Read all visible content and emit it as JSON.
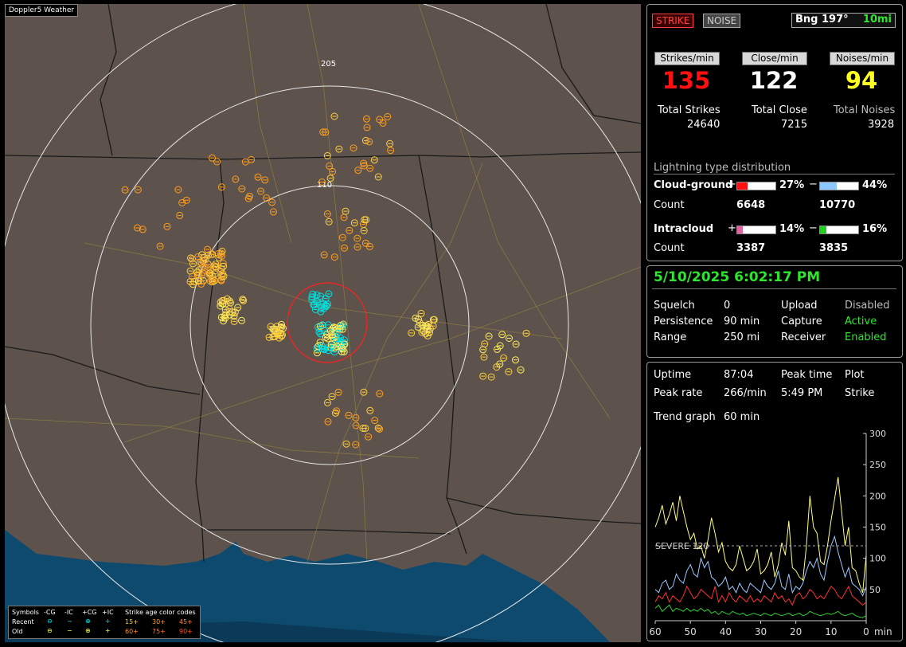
{
  "map": {
    "title": "Doppler5 Weather",
    "ring_labels": [
      "205",
      "110"
    ],
    "legend": {
      "symbols_label": "Symbols",
      "col_neg_cg": "-CG",
      "col_neg_ic": "-IC",
      "col_pos_cg": "+CG",
      "col_pos_ic": "+IC",
      "age_title": "Strike age color codes",
      "recent_label": "Recent",
      "old_label": "Old",
      "recent_ages": [
        "15+",
        "30+",
        "45+"
      ],
      "old_ages": [
        "60+",
        "75+",
        "90+"
      ],
      "colors": {
        "recent": "#00e0e0",
        "old": "#ffff40",
        "age15": "#ffd040",
        "age30": "#ffa020",
        "age45": "#ff8020",
        "age60": "#ff9020",
        "age75": "#ff7020",
        "age90": "#ff5020"
      }
    }
  },
  "status": {
    "strike_label": "STRIKE",
    "noise_label": "NOISE",
    "bearing": "Bng 197°",
    "distance": "10mi",
    "strikes_min_label": "Strikes/min",
    "close_min_label": "Close/min",
    "noises_min_label": "Noises/min",
    "strikes_min": "135",
    "close_min": "122",
    "noises_min": "94",
    "total_strikes_label": "Total Strikes",
    "total_close_label": "Total Close",
    "total_noises_label": "Total Noises",
    "total_strikes": "24640",
    "total_close": "7215",
    "total_noises": "3928",
    "dist_title": "Lightning type distribution",
    "cg_label": "Cloud-ground",
    "ic_label": "Intracloud",
    "plus": "+",
    "minus": "−",
    "cg_pos_pct": "27%",
    "cg_neg_pct": "44%",
    "ic_pos_pct": "14%",
    "ic_neg_pct": "16%",
    "cg_pos_frac": 0.27,
    "cg_neg_frac": 0.44,
    "ic_pos_frac": 0.14,
    "ic_neg_frac": 0.16,
    "count_label": "Count",
    "cg_pos_count": "6648",
    "cg_neg_count": "10770",
    "ic_pos_count": "3387",
    "ic_neg_count": "3835"
  },
  "settings": {
    "datetime": "5/10/2025 6:02:17 PM",
    "squelch_label": "Squelch",
    "squelch": "0",
    "persistence_label": "Persistence",
    "persistence": "90 min",
    "range_label": "Range",
    "range": "250 mi",
    "upload_label": "Upload",
    "upload": "Disabled",
    "capture_label": "Capture",
    "capture": "Active",
    "receiver_label": "Receiver",
    "receiver": "Enabled"
  },
  "stats": {
    "uptime_label": "Uptime",
    "uptime": "87:04",
    "peak_time_label": "Peak time",
    "peak_time": "5:49 PM",
    "plot_label": "Plot",
    "plot": "Strike",
    "peak_rate_label": "Peak rate",
    "peak_rate": "266/min",
    "trend_label": "Trend graph",
    "trend": "60 min"
  },
  "chart_data": {
    "type": "line",
    "title": "",
    "xlabel": "min",
    "ylabel": "",
    "x_ticks": [
      "60",
      "50",
      "40",
      "30",
      "20",
      "10",
      "0"
    ],
    "xlim": [
      60,
      0
    ],
    "y_ticks": [
      "300",
      "250",
      "200",
      "150",
      "100",
      "50"
    ],
    "ylim": [
      0,
      300
    ],
    "severe_label": "SEVERE 120",
    "severe_value": 120,
    "series": [
      {
        "color": "#ffff80",
        "values": [
          150,
          165,
          185,
          155,
          170,
          190,
          160,
          200,
          175,
          150,
          130,
          140,
          115,
          120,
          100,
          130,
          165,
          140,
          110,
          125,
          95,
          85,
          80,
          90,
          120,
          100,
          80,
          85,
          95,
          115,
          75,
          80,
          90,
          110,
          70,
          90,
          125,
          105,
          160,
          85,
          80,
          70,
          65,
          120,
          200,
          150,
          140,
          95,
          90,
          120,
          160,
          195,
          230,
          175,
          120,
          150,
          85,
          80,
          60,
          45,
          105
        ]
      },
      {
        "color": "#9ec8ff",
        "values": [
          50,
          45,
          60,
          65,
          50,
          55,
          75,
          65,
          60,
          80,
          90,
          75,
          70,
          100,
          85,
          95,
          70,
          65,
          55,
          60,
          70,
          50,
          55,
          45,
          60,
          50,
          45,
          60,
          55,
          50,
          45,
          65,
          55,
          50,
          60,
          80,
          55,
          50,
          75,
          45,
          55,
          50,
          60,
          80,
          95,
          85,
          100,
          75,
          65,
          95,
          120,
          135,
          110,
          90,
          70,
          85,
          60,
          55,
          50,
          40,
          55
        ]
      },
      {
        "color": "#ff3030",
        "values": [
          30,
          40,
          35,
          45,
          30,
          40,
          35,
          30,
          40,
          55,
          45,
          35,
          40,
          50,
          45,
          40,
          35,
          55,
          30,
          40,
          30,
          45,
          35,
          30,
          40,
          35,
          30,
          40,
          30,
          35,
          30,
          40,
          35,
          30,
          45,
          35,
          40,
          30,
          35,
          25,
          40,
          45,
          35,
          40,
          50,
          45,
          35,
          40,
          35,
          45,
          55,
          50,
          40,
          35,
          45,
          55,
          40,
          35,
          30,
          25,
          30
        ]
      },
      {
        "color": "#30d030",
        "values": [
          20,
          25,
          15,
          20,
          25,
          15,
          20,
          18,
          15,
          20,
          15,
          18,
          15,
          20,
          15,
          18,
          12,
          15,
          10,
          15,
          12,
          10,
          15,
          12,
          10,
          12,
          8,
          10,
          12,
          10,
          8,
          12,
          10,
          8,
          12,
          10,
          8,
          10,
          12,
          8,
          10,
          12,
          8,
          10,
          15,
          12,
          10,
          8,
          10,
          12,
          10,
          12,
          15,
          10,
          8,
          10,
          12,
          8,
          6,
          5,
          8
        ]
      }
    ]
  }
}
